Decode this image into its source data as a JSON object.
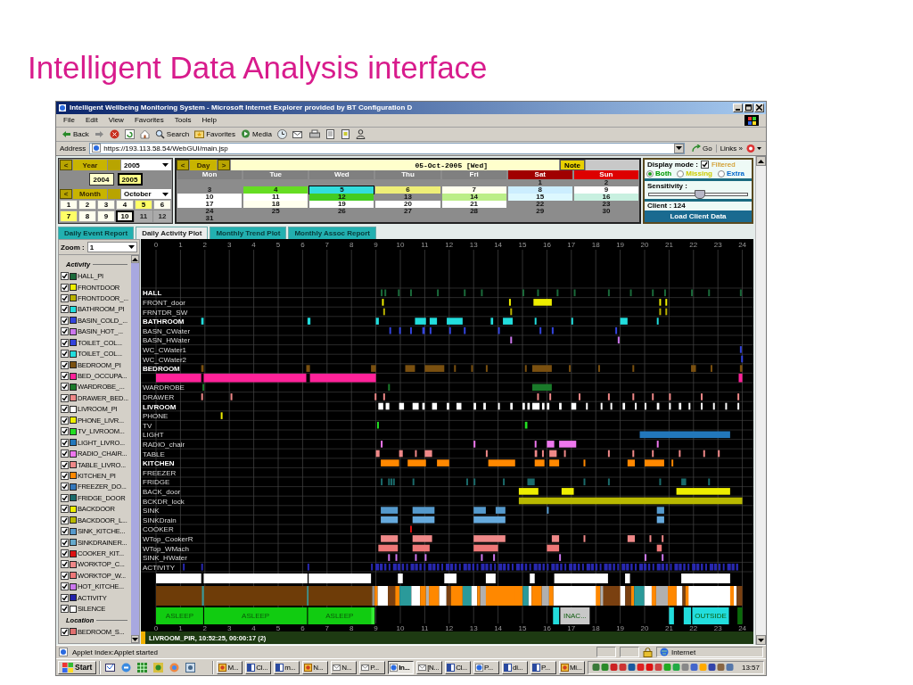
{
  "slide": {
    "title": "Intelligent Data Analysis interface"
  },
  "window": {
    "title": "Intelligent Wellbeing Monitoring System - Microsoft Internet Explorer provided by BT Configuration D"
  },
  "menu": [
    "File",
    "Edit",
    "View",
    "Favorites",
    "Tools",
    "Help"
  ],
  "toolbar": [
    {
      "kind": "back",
      "label": "Back"
    },
    {
      "kind": "search",
      "label": "Search"
    },
    {
      "kind": "favorites",
      "label": "Favorites"
    },
    {
      "kind": "media",
      "label": "Media"
    }
  ],
  "address": {
    "label": "Address",
    "value": "https://193.113.58.54/WebGUI/main.jsp",
    "go": "Go",
    "links": "Links »"
  },
  "year": {
    "prev": "<",
    "label": "Year",
    "value": "2005",
    "buttons": [
      {
        "label": "2004",
        "selected": false
      },
      {
        "label": "2005",
        "selected": true
      }
    ]
  },
  "month": {
    "prev": "<",
    "label": "Month",
    "value": "October",
    "months": [
      {
        "label": "1",
        "selected": false,
        "highlighted": false,
        "disabled": false
      },
      {
        "label": "2",
        "selected": false,
        "highlighted": false,
        "disabled": false
      },
      {
        "label": "3",
        "selected": false,
        "highlighted": false,
        "disabled": false
      },
      {
        "label": "4",
        "selected": false,
        "highlighted": false,
        "disabled": false
      },
      {
        "label": "5",
        "selected": false,
        "highlighted": true,
        "disabled": false
      },
      {
        "label": "6",
        "selected": false,
        "highlighted": false,
        "disabled": false
      },
      {
        "label": "7",
        "selected": false,
        "highlighted": true,
        "disabled": false
      },
      {
        "label": "8",
        "selected": false,
        "highlighted": false,
        "disabled": false
      },
      {
        "label": "9",
        "selected": false,
        "highlighted": false,
        "disabled": false
      },
      {
        "label": "10",
        "selected": true,
        "highlighted": false,
        "disabled": false
      },
      {
        "label": "11",
        "selected": false,
        "highlighted": false,
        "disabled": true
      },
      {
        "label": "12",
        "selected": false,
        "highlighted": false,
        "disabled": true
      }
    ]
  },
  "day": {
    "prev": "<",
    "label": "Day",
    "next": ">",
    "date": "05-Oct-2005 [Wed]",
    "note": "Note"
  },
  "weekdays": [
    {
      "label": "Mon",
      "color": "#808080"
    },
    {
      "label": "Tue",
      "color": "#808080"
    },
    {
      "label": "Wed",
      "color": "#808080"
    },
    {
      "label": "Thu",
      "color": "#808080"
    },
    {
      "label": "Fri",
      "color": "#808080"
    },
    {
      "label": "Sat",
      "color": "#a00000"
    },
    {
      "label": "Sun",
      "color": "#dd0000"
    }
  ],
  "weeks": [
    [
      {
        "day": "1",
        "selected": false
      },
      {
        "day": "2",
        "selected": false
      }
    ],
    [
      {
        "day": "3",
        "selected": false
      },
      {
        "day": "4",
        "selected": false,
        "color": "#66dd22"
      },
      {
        "day": "5",
        "selected": true,
        "color": "#33dddd"
      },
      {
        "day": "6",
        "selected": false,
        "color": "#eeee77"
      },
      {
        "day": "7",
        "selected": false,
        "color": "#ffffee"
      },
      {
        "day": "8",
        "selected": false,
        "color": "#cceeff"
      },
      {
        "day": "9",
        "selected": false,
        "color": "#ffffff"
      }
    ],
    [
      {
        "day": "10",
        "selected": false,
        "color": "#ffffff"
      },
      {
        "day": "11",
        "selected": false,
        "color": "#ffffff"
      },
      {
        "day": "12",
        "selected": false,
        "color": "#44cc22"
      },
      {
        "day": "13",
        "selected": false
      },
      {
        "day": "14",
        "selected": false,
        "color": "#bbee88"
      },
      {
        "day": "15",
        "selected": false,
        "color": "#ddf8ff"
      },
      {
        "day": "16",
        "selected": false,
        "color": "#c8f0e0"
      }
    ],
    [
      {
        "day": "17",
        "selected": false,
        "color": "#ffffff"
      },
      {
        "day": "18",
        "selected": false,
        "color": "#ffffee"
      },
      {
        "day": "19",
        "selected": false,
        "color": "#ffffff"
      },
      {
        "day": "20",
        "selected": false,
        "color": "#ffffff"
      },
      {
        "day": "21",
        "selected": false,
        "color": "#ffffff"
      },
      {
        "day": "22",
        "selected": false
      },
      {
        "day": "23",
        "selected": false
      }
    ],
    [
      {
        "day": "24",
        "selected": false
      },
      {
        "day": "25",
        "selected": false
      },
      {
        "day": "26",
        "selected": false
      },
      {
        "day": "27",
        "selected": false
      },
      {
        "day": "28",
        "selected": false
      },
      {
        "day": "29",
        "selected": false
      },
      {
        "day": "30",
        "selected": false
      }
    ],
    [
      {
        "day": "31",
        "selected": false
      }
    ]
  ],
  "display": {
    "label": "Display mode :",
    "filtered": {
      "label": "Filtered",
      "checked": true
    },
    "modes": [
      {
        "label": "Both",
        "selected": true,
        "color": "#009900"
      },
      {
        "label": "Missing",
        "selected": false,
        "color": "#cccc00"
      },
      {
        "label": "Extra",
        "selected": false,
        "color": "#0066cc"
      }
    ],
    "sensitivity": {
      "label": "Sensitivity :",
      "level": 0.52
    },
    "client": "Client : 124",
    "load": "Load Client Data"
  },
  "tabs": [
    {
      "label": "Daily Event Report",
      "selected": false
    },
    {
      "label": "Daily Activity Plot",
      "selected": true
    },
    {
      "label": "Monthly Trend Plot",
      "selected": false
    },
    {
      "label": "Monthly Assoc Report",
      "selected": false
    }
  ],
  "zoom": {
    "label": "Zoom :",
    "value": "1"
  },
  "legend": {
    "activity": {
      "title": "Activity",
      "items": [
        {
          "label": "HALL_PI",
          "checked": true,
          "color": "#1a6a3a"
        },
        {
          "label": "FRONTDOOR",
          "checked": true,
          "color": "#eeee00"
        },
        {
          "label": "FRONTDOOR_...",
          "checked": true,
          "color": "#b8b000"
        },
        {
          "label": "BATHROOM_PI",
          "checked": true,
          "color": "#22dddd"
        },
        {
          "label": "BASIN_COLD_...",
          "checked": true,
          "color": "#3344dd"
        },
        {
          "label": "BASIN_HOT_...",
          "checked": true,
          "color": "#cc77ee"
        },
        {
          "label": "TOILET_COL...",
          "checked": true,
          "color": "#3344dd"
        },
        {
          "label": "TOILET_COL...",
          "checked": true,
          "color": "#22dddd"
        },
        {
          "label": "BEDROOM_PI",
          "checked": true,
          "color": "#7a5010"
        },
        {
          "label": "BED_OCCUPA...",
          "checked": true,
          "color": "#ff2299"
        },
        {
          "label": "WARDROBE_...",
          "checked": true,
          "color": "#1a7a2a"
        },
        {
          "label": "DRAWER_BED...",
          "checked": true,
          "color": "#ee8888"
        },
        {
          "label": "LIVROOM_PI",
          "checked": true,
          "color": "#ffffff"
        },
        {
          "label": "PHONE_LIVR...",
          "checked": true,
          "color": "#eeee00"
        },
        {
          "label": "TV_LIVROOM...",
          "checked": true,
          "color": "#22dd22"
        },
        {
          "label": "LIGHT_LIVRO...",
          "checked": true,
          "color": "#2277bb"
        },
        {
          "label": "RADIO_CHAIR...",
          "checked": true,
          "color": "#ee77ee"
        },
        {
          "label": "TABLE_LIVRO...",
          "checked": true,
          "color": "#ee8888"
        },
        {
          "label": "KITCHEN_PI",
          "checked": true,
          "color": "#ff8800"
        },
        {
          "label": "FREEZER_DO...",
          "checked": true,
          "color": "#3377bb"
        },
        {
          "label": "FRIDGE_DOOR",
          "checked": true,
          "color": "#1a6a6a"
        },
        {
          "label": "BACKDOOR",
          "checked": true,
          "color": "#eeee00"
        },
        {
          "label": "BACKDOOR_L...",
          "checked": true,
          "color": "#b8b800"
        },
        {
          "label": "SINK_KITCHE...",
          "checked": true,
          "color": "#5599cc"
        },
        {
          "label": "SINKDRAINER...",
          "checked": true,
          "color": "#66aacc"
        },
        {
          "label": "COOKER_KIT...",
          "checked": true,
          "color": "#dd1111"
        },
        {
          "label": "WORKTOP_C...",
          "checked": true,
          "color": "#ee8888"
        },
        {
          "label": "WORKTOP_W...",
          "checked": true,
          "color": "#ee7777"
        },
        {
          "label": "HOT_KITCHE...",
          "checked": true,
          "color": "#cc77ee"
        },
        {
          "label": "ACTIVITY",
          "checked": true,
          "color": "#2222aa"
        },
        {
          "label": "SILENCE",
          "checked": true,
          "color": "#ffffff"
        }
      ]
    },
    "location": {
      "title": "Location",
      "items": [
        {
          "label": "BEDROOM_S...",
          "checked": true,
          "color": "#e07070"
        }
      ]
    }
  },
  "plot": {
    "top_ticks": [
      "0",
      "1",
      "2",
      "3",
      "4",
      "5",
      "6",
      "7",
      "8",
      "9",
      "10",
      "11",
      "12",
      "13",
      "14",
      "15",
      "16",
      "17",
      "18",
      "19",
      "20",
      "21",
      "22",
      "23",
      "24"
    ],
    "rows": [
      {
        "kind": "group",
        "label": "HALL",
        "color": "#1a6a3a"
      },
      {
        "kind": "sensor",
        "label": "FRONT_door",
        "color": "#eeee00"
      },
      {
        "kind": "sensor",
        "label": "FRNTDR_SW",
        "color": "#b8b000"
      },
      {
        "kind": "group",
        "label": "BATHROOM",
        "color": "#22dddd"
      },
      {
        "kind": "sensor",
        "label": "BASN_CWater",
        "color": "#3344dd"
      },
      {
        "kind": "sensor",
        "label": "BASN_HWater",
        "color": "#cc77ee"
      },
      {
        "kind": "sensor",
        "label": "WC_CWater1",
        "color": "#3344dd"
      },
      {
        "kind": "sensor",
        "label": "WC_CWater2",
        "color": "#3344dd"
      },
      {
        "kind": "group",
        "label": "BEDROOM",
        "color": "#7a5010"
      },
      {
        "kind": "occupancy",
        "color": "#ff2299"
      },
      {
        "kind": "sensor",
        "label": "WARDROBE",
        "color": "#1a7a2a"
      },
      {
        "kind": "sensor",
        "label": "DRAWER",
        "color": "#ee8888"
      },
      {
        "kind": "group",
        "label": "LIVROOM",
        "color": "#ffffff"
      },
      {
        "kind": "sensor",
        "label": "PHONE",
        "color": "#eeee00"
      },
      {
        "kind": "sensor",
        "label": "TV",
        "color": "#22dd22"
      },
      {
        "kind": "sensor",
        "label": "LIGHT",
        "color": "#2277bb"
      },
      {
        "kind": "sensor",
        "label": "RADIO_chair",
        "color": "#ee77ee"
      },
      {
        "kind": "sensor",
        "label": "TABLE",
        "color": "#ee8888"
      },
      {
        "kind": "group",
        "label": "KITCHEN",
        "color": "#ff8800"
      },
      {
        "kind": "sensor",
        "label": "FREEZER"
      },
      {
        "kind": "sensor",
        "label": "FRIDGE",
        "color": "#1a6a6a"
      },
      {
        "kind": "sensor",
        "label": "BACK_door",
        "color": "#eeee00"
      },
      {
        "kind": "sensor",
        "label": "BCKDR_lock",
        "color": "#b8b800"
      },
      {
        "kind": "sensor",
        "label": "SINK",
        "color": "#5599cc"
      },
      {
        "kind": "sensor",
        "label": "SINKDrain",
        "color": "#66aadd"
      },
      {
        "kind": "sensor",
        "label": "COOKER",
        "color": "#dd1111"
      },
      {
        "kind": "sensor",
        "label": "WTop_CookerR",
        "color": "#ee8888"
      },
      {
        "kind": "sensor",
        "label": "WTop_WMach",
        "color": "#ee7777"
      },
      {
        "kind": "sensor",
        "label": "SINK_HWater",
        "color": "#cc77ee"
      },
      {
        "kind": "sensor",
        "label": "ACTIVITY",
        "color": "#2828b0"
      }
    ],
    "state_labels": [
      "ASLEEP",
      "ASLEEP",
      "ASLEEP",
      "INAC...",
      "OUTSIDE"
    ],
    "bottom_ticks": [
      "0",
      "1",
      "2",
      "3",
      "4",
      "5",
      "6",
      "7",
      "8",
      "9",
      "10",
      "11",
      "12",
      "13",
      "14",
      "15",
      "16",
      "17",
      "18",
      "19",
      "20",
      "21",
      "22",
      "23",
      "24"
    ],
    "status": "LIVROOM_PIR, 10:52:25, 00:00:17 (2)"
  },
  "status_bar": {
    "text": "Applet Index:Applet started",
    "zone": "Internet"
  },
  "taskbar": {
    "start": "Start",
    "tasks": [
      {
        "kind": "app",
        "label": "M...",
        "selected": false
      },
      {
        "kind": "word",
        "label": "Cl...",
        "selected": false
      },
      {
        "kind": "word",
        "label": "m...",
        "selected": false
      },
      {
        "kind": "app",
        "label": "N...",
        "selected": false
      },
      {
        "kind": "mail",
        "label": "N...",
        "selected": false
      },
      {
        "kind": "mail",
        "label": "P...",
        "selected": false
      },
      {
        "kind": "browser",
        "label": "In...",
        "selected": true
      },
      {
        "kind": "mail",
        "label": "[N...",
        "selected": false
      },
      {
        "kind": "word",
        "label": "Cl...",
        "selected": false
      },
      {
        "kind": "browser",
        "label": "P...",
        "selected": false
      },
      {
        "kind": "word",
        "label": "di...",
        "selected": false
      },
      {
        "kind": "word",
        "label": "P...",
        "selected": false
      },
      {
        "kind": "app",
        "label": "Mi...",
        "selected": false
      }
    ],
    "clock": "13:57"
  }
}
